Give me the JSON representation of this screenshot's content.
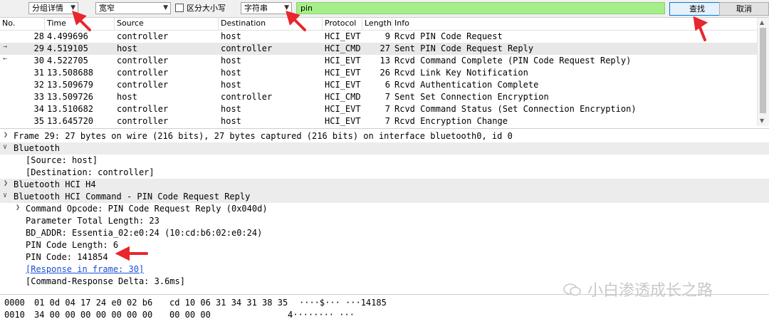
{
  "toolbar": {
    "search_in": "分组详情",
    "char_width": "宽窄",
    "case_sensitive": "区分大小写",
    "search_type": "字符串",
    "filter_value": "pin",
    "find_label": "查找",
    "cancel_label": "取消"
  },
  "packet_list": {
    "columns": [
      "No.",
      "Time",
      "Source",
      "Destination",
      "Protocol",
      "Length",
      "Info"
    ],
    "rows": [
      {
        "no": "28",
        "time": "4.499696",
        "src": "controller",
        "dst": "host",
        "proto": "HCI_EVT",
        "len": "9",
        "info": "Rcvd PIN Code Request"
      },
      {
        "no": "29",
        "time": "4.519105",
        "src": "host",
        "dst": "controller",
        "proto": "HCI_CMD",
        "len": "27",
        "info": "Sent PIN Code Request Reply"
      },
      {
        "no": "30",
        "time": "4.522705",
        "src": "controller",
        "dst": "host",
        "proto": "HCI_EVT",
        "len": "13",
        "info": "Rcvd Command Complete (PIN Code Request Reply)"
      },
      {
        "no": "31",
        "time": "13.508688",
        "src": "controller",
        "dst": "host",
        "proto": "HCI_EVT",
        "len": "26",
        "info": "Rcvd Link Key Notification"
      },
      {
        "no": "32",
        "time": "13.509679",
        "src": "controller",
        "dst": "host",
        "proto": "HCI_EVT",
        "len": "6",
        "info": "Rcvd Authentication Complete"
      },
      {
        "no": "33",
        "time": "13.509726",
        "src": "host",
        "dst": "controller",
        "proto": "HCI_CMD",
        "len": "7",
        "info": "Sent Set Connection Encryption"
      },
      {
        "no": "34",
        "time": "13.510682",
        "src": "controller",
        "dst": "host",
        "proto": "HCI_EVT",
        "len": "7",
        "info": "Rcvd Command Status (Set Connection Encryption)"
      },
      {
        "no": "35",
        "time": "13.645720",
        "src": "controller",
        "dst": "host",
        "proto": "HCI_EVT",
        "len": "7",
        "info": "Rcvd Encryption Change"
      }
    ]
  },
  "details": {
    "frame": "Frame 29: 27 bytes on wire (216 bits), 27 bytes captured (216 bits) on interface bluetooth0, id 0",
    "bluetooth": "Bluetooth",
    "source": "[Source: host]",
    "destination": "[Destination: controller]",
    "hci_h4": "Bluetooth HCI H4",
    "hci_cmd": "Bluetooth HCI Command - PIN Code Request Reply",
    "opcode": "Command Opcode: PIN Code Request Reply (0x040d)",
    "param_len": "Parameter Total Length: 23",
    "bd_addr": "BD_ADDR: Essentia_02:e0:24 (10:cd:b6:02:e0:24)",
    "pin_len": "PIN Code Length: 6",
    "pin_code": "PIN Code: 141854",
    "response": "[Response in frame: 30]",
    "delta": "[Command-Response Delta: 3.6ms]"
  },
  "bytes": {
    "rows": [
      {
        "offset": "0000",
        "hex1": "01 0d 04 17 24 e0 02 b6",
        "hex2": "cd 10 06 31 34 31 38 35",
        "ascii": "····$··· ···14185"
      },
      {
        "offset": "0010",
        "hex1": "34 00 00 00 00 00 00 00",
        "hex2": "00 00 00",
        "ascii": "4········ ···"
      }
    ]
  },
  "watermark": "小白渗透成长之路",
  "colors": {
    "filter_bg": "#a5ef8a",
    "selected_row": "#e8e8e8",
    "annotation_arrow": "#e8262c",
    "link": "#1a4fd6"
  }
}
